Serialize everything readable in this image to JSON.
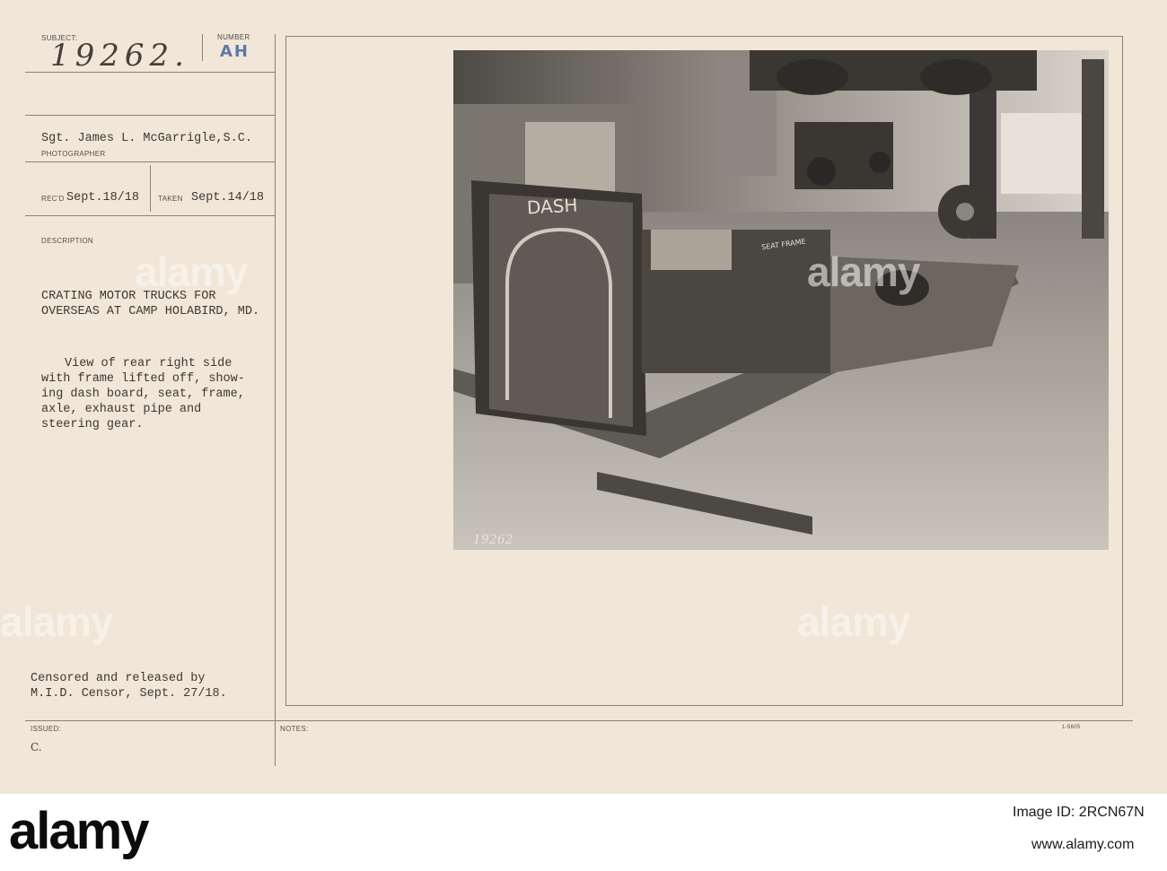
{
  "labels": {
    "subject": "SUBJECT:",
    "number": "NUMBER",
    "photographer": "PHOTOGRAPHER",
    "recd": "REC'D",
    "taken": "TAKEN",
    "description": "DESCRIPTION",
    "issued": "ISSUED:",
    "notes": "NOTES:"
  },
  "subject_number": "19262.",
  "number_code": "AH",
  "photographer_name": "Sgt. James L. McGarrigle,S.C.",
  "recd_date": "Sept.18/18",
  "taken_date": "Sept.14/18",
  "title_line1": "CRATING MOTOR TRUCKS FOR",
  "title_line2": "OVERSEAS AT CAMP HOLABIRD, MD.",
  "desc_line1": "View of rear right side",
  "desc_line2": "with frame lifted off, show-",
  "desc_line3": "ing dash board, seat, frame,",
  "desc_line4": "axle, exhaust pipe and",
  "desc_line5": "steering gear.",
  "censor_line1": "Censored and released by",
  "censor_line2": "M.I.D. Censor, Sept. 27/18.",
  "issued_mark": "C.",
  "form_code": "1-5605",
  "photo": {
    "dash_label": "DASH",
    "seat_frame_label": "SEAT FRAME",
    "neg_number": "19262"
  },
  "watermarks": [
    "alamy",
    "alamy",
    "alamy",
    "alamy"
  ],
  "footer": {
    "logo": "alamy",
    "image_id_label": "Image ID: 2RCN67N",
    "url": "www.alamy.com"
  }
}
